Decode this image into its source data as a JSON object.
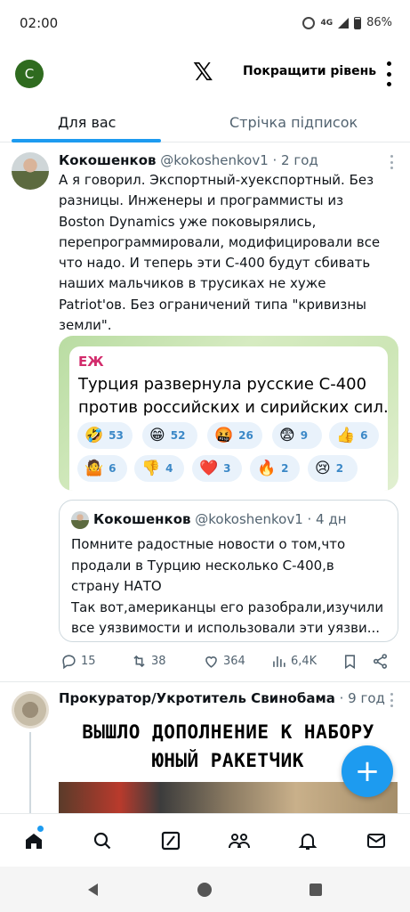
{
  "status": {
    "time": "02:00",
    "network": "4G",
    "battery": "86%"
  },
  "header": {
    "avatar_letter": "C",
    "logo": "𝕏",
    "upgrade_label": "Покращити рівень"
  },
  "tabs": [
    {
      "label": "Для вас",
      "active": true
    },
    {
      "label": "Стрічка підписок",
      "active": false
    }
  ],
  "post1": {
    "author": "Кокошенков",
    "handle": "@kokoshenkov1",
    "time": " · 2 год",
    "text_lines": [
      "А я говорил. Экспортный-хуекспортный. Без",
      "разницы. Инженеры и программисты из",
      "Boston Dynamics уже поковырялись,",
      "перепрограммировали, модифицировали все",
      "что надо. И теперь эти С-400 будут сбивать",
      "наших мальчиков в трусиках не хуже",
      "Patriot'ов. Без ограничений типа \"кривизны",
      "земли\"."
    ],
    "image": {
      "channel": "ЕЖ",
      "headline_lines": [
        "Турция развернула русские С-400",
        "против российских и сирийских сил."
      ],
      "reactions": [
        {
          "emoji": "🤣",
          "count": "53"
        },
        {
          "emoji": "😁",
          "count": "52"
        },
        {
          "emoji": "🤬",
          "count": "26"
        },
        {
          "emoji": "😨",
          "count": "9"
        },
        {
          "emoji": "👍",
          "count": "6"
        },
        {
          "emoji": "🤷",
          "count": "6"
        },
        {
          "emoji": "👎",
          "count": "4"
        },
        {
          "emoji": "❤️",
          "count": "3"
        },
        {
          "emoji": "🔥",
          "count": "2"
        },
        {
          "emoji": "😢",
          "count": "2"
        }
      ]
    },
    "quote": {
      "author": "Кокошенков",
      "handle": "@kokoshenkov1",
      "time": " · 4 дн",
      "text_lines": [
        "Помните радостные новости о том,что",
        "продали в Турцию несколько С-400,в",
        "страну НАТО",
        "Так вот,американцы его разобрали,изучили",
        "все уязвимости и использовали эти уязви..."
      ]
    },
    "stats": {
      "replies": "15",
      "reposts": "38",
      "likes": "364",
      "views": "6,4K"
    }
  },
  "post2": {
    "author": "Прокуратор/Укротитель Свинобама",
    "time": " · 9 год",
    "image_lines": [
      "ВЫШЛО ДОПОЛНЕНИЕ К НАБОРУ",
      "ЮНЫЙ РАКЕТЧИК"
    ]
  },
  "fab_label": "+",
  "bottom_nav": [
    "home-icon",
    "search-icon",
    "grok-icon",
    "communities-icon",
    "notifications-icon",
    "messages-icon"
  ],
  "colors": {
    "accent": "#1d9bf0",
    "text": "#0f1419",
    "muted": "#536471",
    "channel": "#d22b6b"
  }
}
